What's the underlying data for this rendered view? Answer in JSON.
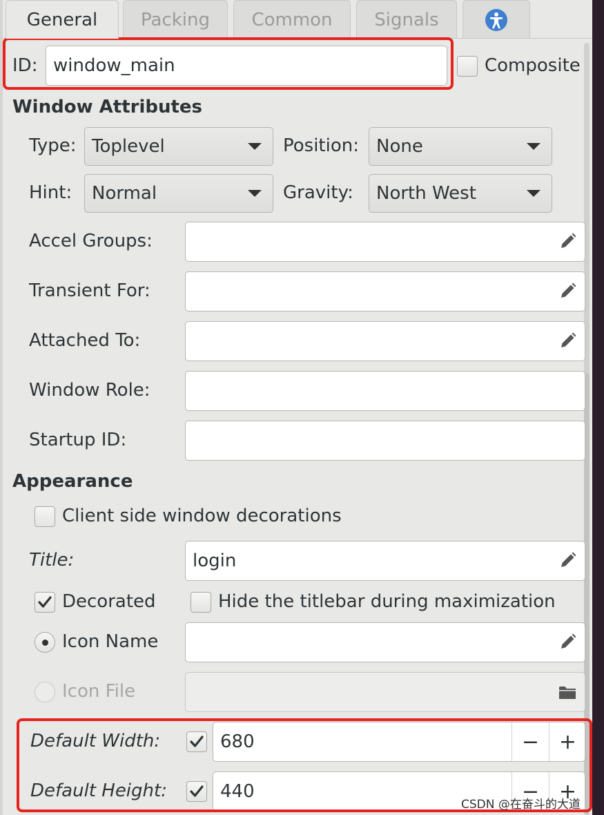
{
  "tabs": [
    {
      "label": "General",
      "active": true
    },
    {
      "label": "Packing"
    },
    {
      "label": "Common"
    },
    {
      "label": "Signals"
    }
  ],
  "accessibility_tab_icon": "accessibility-icon",
  "id_row": {
    "label": "ID:",
    "value": "window_main",
    "composite_label": "Composite",
    "composite_checked": false
  },
  "window_attributes": {
    "heading": "Window Attributes",
    "type_label": "Type:",
    "type_value": "Toplevel",
    "position_label": "Position:",
    "position_value": "None",
    "hint_label": "Hint:",
    "hint_value": "Normal",
    "gravity_label": "Gravity:",
    "gravity_value": "North West",
    "accel_groups_label": "Accel Groups:",
    "accel_groups_value": "",
    "transient_for_label": "Transient For:",
    "transient_for_value": "",
    "attached_to_label": "Attached To:",
    "attached_to_value": "",
    "window_role_label": "Window Role:",
    "window_role_value": "",
    "startup_id_label": "Startup ID:",
    "startup_id_value": ""
  },
  "appearance": {
    "heading": "Appearance",
    "csd_label": "Client side window decorations",
    "csd_checked": false,
    "title_label": "Title:",
    "title_value": "login",
    "decorated_label": "Decorated",
    "decorated_checked": true,
    "hide_titlebar_label": "Hide the titlebar during maximization",
    "hide_titlebar_checked": false,
    "icon_name_label": "Icon Name",
    "icon_name_selected": true,
    "icon_name_value": "",
    "icon_file_label": "Icon File",
    "icon_file_selected": false
  },
  "size": {
    "default_width_label": "Default Width:",
    "default_width_checked": true,
    "default_width_value": "680",
    "default_height_label": "Default Height:",
    "default_height_checked": true,
    "default_height_value": "440",
    "minus_label": "−",
    "plus_label": "+"
  },
  "watermark": "CSDN @在奋斗的大道",
  "colors": {
    "highlight": "#e3231c",
    "background": "#e8e8e7"
  }
}
